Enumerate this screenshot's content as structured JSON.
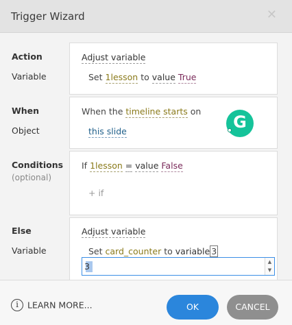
{
  "dialog": {
    "title": "Trigger Wizard",
    "close_glyph": "✕"
  },
  "action": {
    "label": "Action",
    "sub_label": "Variable",
    "value": "Adjust variable",
    "line_prefix": "Set",
    "variable": "1lesson",
    "to_text": "to",
    "op": "value",
    "value_text": "True"
  },
  "when": {
    "label": "When",
    "sub_label": "Object",
    "prefix": "When the",
    "event": "timeline starts",
    "on_text": "on",
    "object": "this slide"
  },
  "conditions": {
    "label": "Conditions",
    "sub_label": "(optional)",
    "if_text": "If",
    "variable": "1lesson",
    "operator": "=",
    "op": "value",
    "value_text": "False",
    "add_if": "+ if"
  },
  "else": {
    "label": "Else",
    "sub_label": "Variable",
    "value": "Adjust variable",
    "line_prefix": "Set",
    "variable": "card_counter",
    "to_text": "to",
    "op": "variable",
    "value_text": "3",
    "input_value": "3"
  },
  "grammarly": {
    "letter": "G"
  },
  "footer": {
    "info_glyph": "i",
    "learn_more": "LEARN MORE...",
    "ok": "OK",
    "cancel": "CANCEL"
  },
  "colors": {
    "ok_button": "#2b86dc",
    "cancel_button": "#8f8f8f",
    "grammarly": "#15c39a",
    "variable_text": "#8a7a1a",
    "value_text": "#7a2a5a"
  }
}
